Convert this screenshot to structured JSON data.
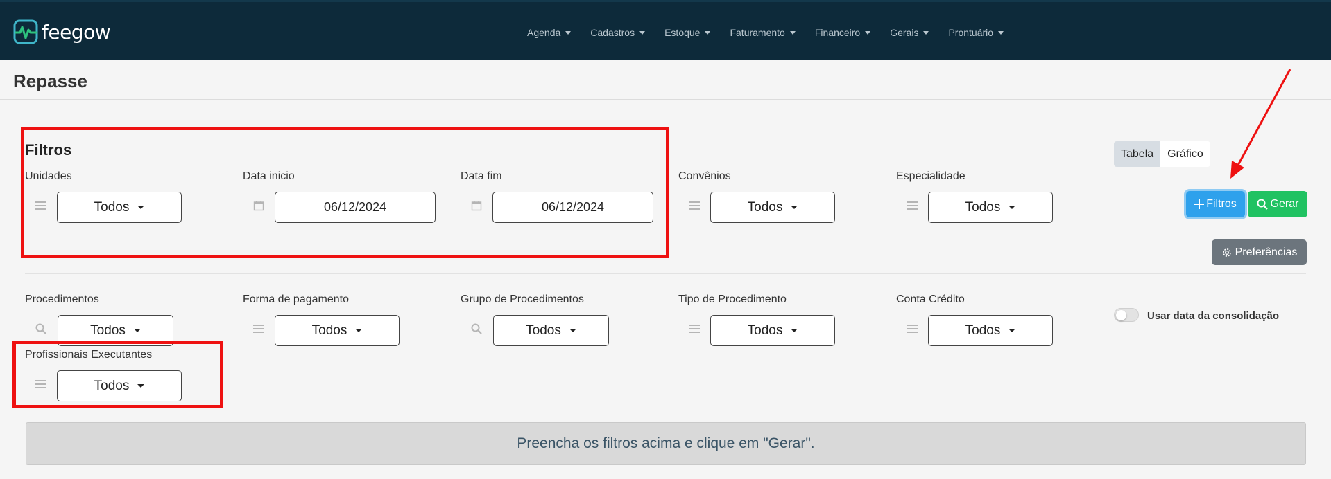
{
  "brand": {
    "name": "feegow"
  },
  "nav": {
    "items": [
      {
        "label": "Agenda"
      },
      {
        "label": "Cadastros"
      },
      {
        "label": "Estoque"
      },
      {
        "label": "Faturamento"
      },
      {
        "label": "Financeiro"
      },
      {
        "label": "Gerais"
      },
      {
        "label": "Prontuário"
      }
    ]
  },
  "page": {
    "title": "Repasse"
  },
  "filters": {
    "section_title": "Filtros",
    "unidades": {
      "label": "Unidades",
      "value": "Todos"
    },
    "data_inicio": {
      "label": "Data inicio",
      "value": "06/12/2024"
    },
    "data_fim": {
      "label": "Data fim",
      "value": "06/12/2024"
    },
    "convenios": {
      "label": "Convênios",
      "value": "Todos"
    },
    "especialidade": {
      "label": "Especialidade",
      "value": "Todos"
    },
    "procedimentos": {
      "label": "Procedimentos",
      "value": "Todos"
    },
    "forma_pagamento": {
      "label": "Forma de pagamento",
      "value": "Todos"
    },
    "grupo_procedimentos": {
      "label": "Grupo de Procedimentos",
      "value": "Todos"
    },
    "tipo_procedimento": {
      "label": "Tipo de Procedimento",
      "value": "Todos"
    },
    "conta_credito": {
      "label": "Conta Crédito",
      "value": "Todos"
    },
    "profissionais": {
      "label": "Profissionais Executantes",
      "value": "Todos"
    }
  },
  "view_toggle": {
    "tabela": "Tabela",
    "grafico": "Gráfico",
    "active": "Tabela"
  },
  "actions": {
    "filtros": "Filtros",
    "gerar": "Gerar",
    "preferencias": "Preferências"
  },
  "consolidacao": {
    "label": "Usar data da consolidação",
    "checked": false
  },
  "info": {
    "message": "Preencha os filtros acima e clique em \"Gerar\"."
  },
  "colors": {
    "navbar": "#0d2a3a",
    "filtros_button": "#2ea1ec",
    "gerar_button": "#20c262",
    "preferencias_button": "#6c757d",
    "annotation": "#ee1111"
  }
}
